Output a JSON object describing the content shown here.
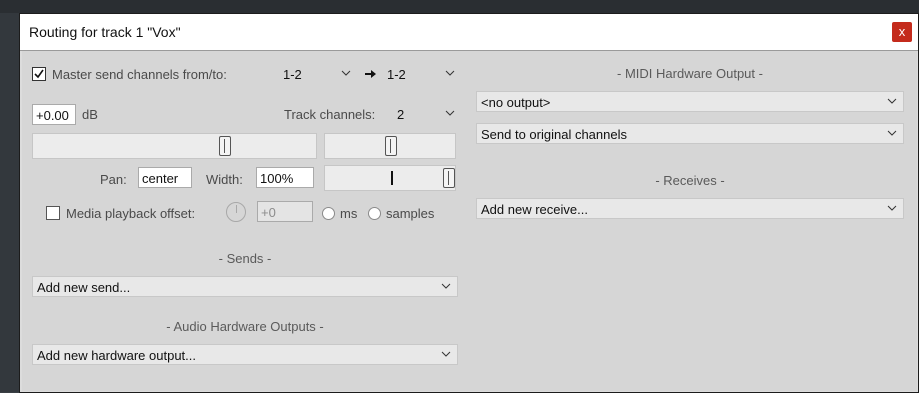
{
  "window": {
    "title": "Routing for track 1 \"Vox\"",
    "close_glyph": "x"
  },
  "master_send": {
    "label": "Master send channels from/to:",
    "checked": true,
    "from": "1-2",
    "to": "1-2",
    "arrow_icon": "arrow-right-icon"
  },
  "volume": {
    "value": "+0.00",
    "unit": "dB"
  },
  "track_channels": {
    "label": "Track channels:",
    "value": "2"
  },
  "pan": {
    "label": "Pan:",
    "value": "center"
  },
  "width": {
    "label": "Width:",
    "value": "100%"
  },
  "media_offset": {
    "label": "Media playback offset:",
    "checked": false,
    "value": "+0",
    "unit_ms": "ms",
    "unit_samples": "samples"
  },
  "sends": {
    "header": "- Sends -",
    "dropdown": "Add new send..."
  },
  "audio_hw": {
    "header": "- Audio Hardware Outputs -",
    "dropdown": "Add new hardware output..."
  },
  "midi_hw": {
    "header": "- MIDI Hardware Output -",
    "output": "<no output>",
    "channels": "Send to original channels"
  },
  "receives": {
    "header": "- Receives -",
    "dropdown": "Add new receive..."
  },
  "colors": {
    "close_button": "#c42b1c",
    "dialog_bg": "#d6d6d6",
    "titlebar_bg": "#ffffff"
  }
}
